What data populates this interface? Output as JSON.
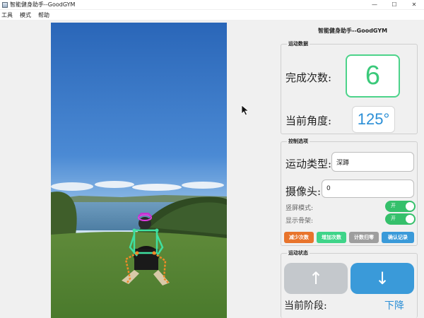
{
  "window": {
    "title": "智能健身助手--GoodGYM",
    "minimize": "—",
    "maximize": "☐",
    "close": "✕"
  },
  "menu": {
    "items": [
      "工具",
      "模式",
      "帮助"
    ]
  },
  "app_heading": "智能健身助手--GoodGYM",
  "motion_data": {
    "group_title": "运动数据",
    "count_label": "完成次数:",
    "count_value": "6",
    "angle_label": "当前角度:",
    "angle_value": "125°"
  },
  "controls": {
    "group_title": "控制选项",
    "exercise_type_label": "运动类型:",
    "exercise_type_value": "深蹲",
    "camera_label": "摄像头:",
    "camera_value": "0",
    "portrait_label": "竖屏模式:",
    "portrait_toggle_text": "开",
    "skeleton_label": "显示骨架:",
    "skeleton_toggle_text": "开",
    "buttons": {
      "decrease": "减少次数",
      "increase": "增加次数",
      "reset": "计数归零",
      "confirm": "确认记录"
    },
    "colors": {
      "decrease": "#e8742c",
      "increase": "#3fd489",
      "reset": "#9e9e9e",
      "confirm": "#3a9ad9"
    }
  },
  "motion_state": {
    "group_title": "运动状态",
    "up_arrow": "↑",
    "down_arrow": "↓",
    "phase_label": "当前阶段:",
    "phase_value": "下降"
  }
}
